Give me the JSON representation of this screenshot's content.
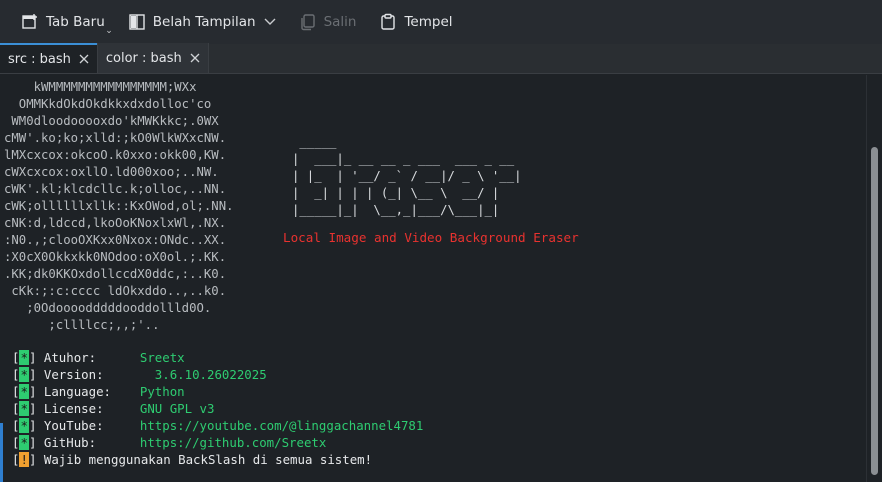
{
  "toolbar": {
    "new_tab": "Tab Baru",
    "split_view": "Belah Tampilan",
    "copy": "Salin",
    "paste": "Tempel"
  },
  "tabs": [
    {
      "label": "src : bash",
      "active": true
    },
    {
      "label": "color : bash",
      "active": false
    }
  ],
  "terminal": {
    "logo_lines": [
      "    kWMMMMMMMMMMMMMMMM;WXx",
      "  OMMKkdOkdOkdkkxdxdolloc'co",
      " WM0dloodooooxdo'kMWKkkc;.0WX",
      "cMW'.ko;ko;xlld:;kO0WlkWXxcNW.",
      "lMXcxcox:okcoO.k0xxo:okk00,KW.",
      "cWXcxcox:oxllO.ld000xoo;..NW.",
      "cWK'.kl;klcdcllc.k;olloc,..NN.",
      "cWK;ollllllxllk::KxOWod,ol;.NN.",
      "cNK:d,ldccd,lkoOoKNoxlxWl,.NX.",
      ":N0.,;clooOXKxx0Nxox:ONdc..XX.",
      ":X0cX0Okkxkk0NOdoo:oX0ol.;.KK.",
      ".KK;dk0KKOxdollccdX0ddc,:..K0.",
      " cKk:;:c:cccc ldOkxddo..,..k0.",
      "   ;0Odoooodddddooddollld0O.",
      "      ;cllllcc;,,;'.."
    ],
    "banner_lines": [
      " _____",
      "|  ___|_ __ __ _ ___  ___ _ __",
      "| |_  | '__/ _` / __|/ _ \\ '__|",
      "|  _| | | | (_| \\__ \\  __/ |",
      "|_____|_|  \\__,_|___/\\___|_|"
    ],
    "tagline": "Local Image and Video Background Eraser",
    "info": [
      {
        "mark": "*",
        "key": "Atuhor:",
        "value": "Sreetx"
      },
      {
        "mark": "*",
        "key": "Version:",
        "value": "  3.6.10.26022025"
      },
      {
        "mark": "*",
        "key": "Language:",
        "value": "Python"
      },
      {
        "mark": "*",
        "key": "License:",
        "value": "GNU GPL v3"
      },
      {
        "mark": "*",
        "key": "YouTube:",
        "value": "https://youtube.com/@linggachannel4781"
      },
      {
        "mark": "*",
        "key": "GitHub:",
        "value": "https://github.com/Sreetx"
      }
    ],
    "warning": {
      "mark": "!",
      "text": "Wajib menggunakan BackSlash di semua sistem!"
    }
  },
  "colors": {
    "accent": "#3b8fd6",
    "green": "#2ecc71",
    "red": "#e8322f",
    "warn": "#f0a030"
  }
}
